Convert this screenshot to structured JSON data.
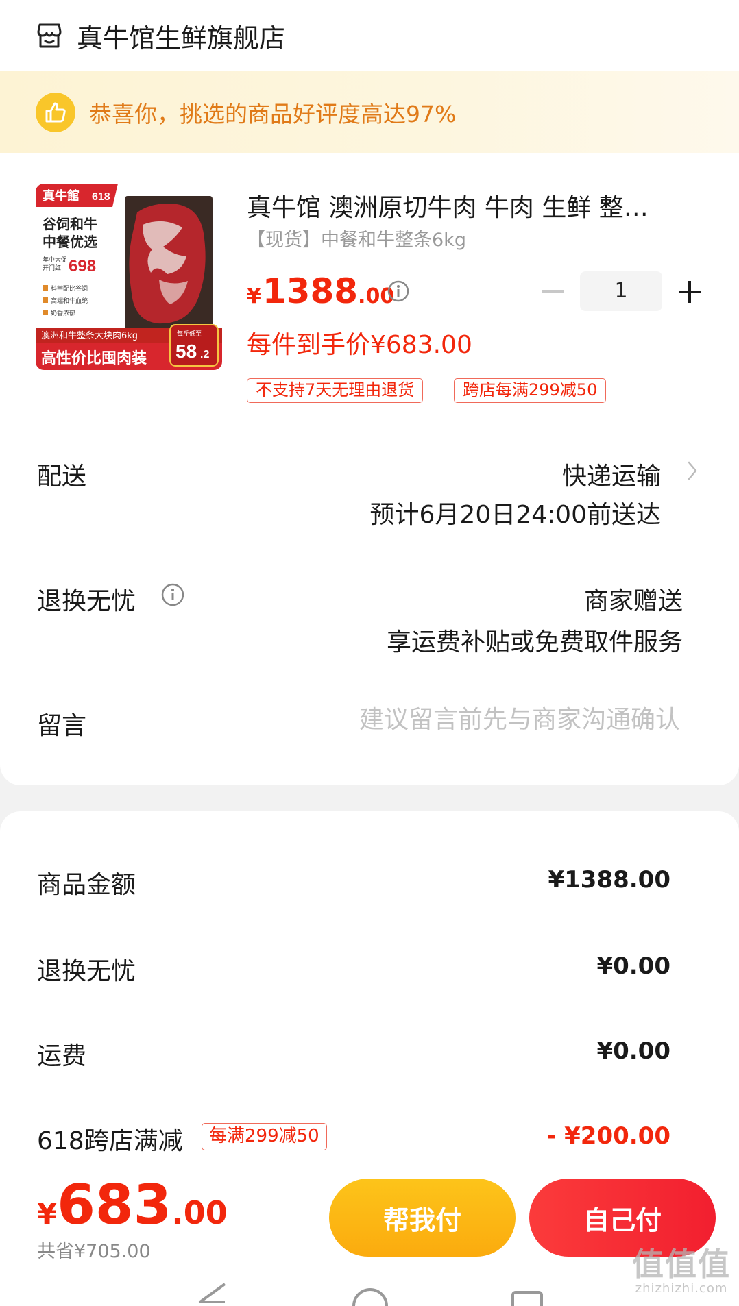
{
  "store": {
    "name": "真牛馆生鲜旗舰店"
  },
  "banner": {
    "text": "恭喜你，挑选的商品好评度高达97%"
  },
  "product": {
    "image": {
      "brand": "真牛館",
      "event": "618",
      "headline1": "谷饲和牛",
      "headline2": "中餐优选",
      "promo_label1": "年中大促",
      "promo_label2": "开门红:",
      "promo_price": "698",
      "features": [
        "科学配比谷饲",
        "高端和牛血统",
        "奶香浓郁"
      ],
      "strip": "澳洲和牛整条大块肉6kg",
      "slogan": "高性价比囤肉装",
      "badge_label": "每斤低至",
      "badge_price": "58",
      "badge_price_dec": ".2"
    },
    "title": "真牛馆 澳洲原切牛肉 牛肉 生鲜 整…",
    "spec": "【现货】中餐和牛整条6kg",
    "price": {
      "yen": "¥",
      "int": "1388",
      "dec": ".00"
    },
    "quantity": "1",
    "deal_price": "每件到手价¥683.00",
    "tags": [
      "不支持7天无理由退货",
      "跨店每满299减50"
    ]
  },
  "delivery": {
    "label": "配送",
    "method": "快递运输",
    "eta": "预计6月20日24:00前送达"
  },
  "returns": {
    "label": "退换无忧",
    "value": "商家赠送",
    "desc": "享运费补贴或免费取件服务"
  },
  "message": {
    "label": "留言",
    "placeholder": "建议留言前先与商家沟通确认"
  },
  "summary": {
    "goods_label": "商品金额",
    "goods_value": "¥1388.00",
    "returns_label": "退换无忧",
    "returns_value": "¥0.00",
    "shipping_label": "运费",
    "shipping_value": "¥0.00",
    "discount_label": "618跨店满减",
    "discount_tag": "每满299减50",
    "discount_value": "- ¥200.00"
  },
  "footer": {
    "total": {
      "yen": "¥",
      "int": "683",
      "dec": ".00"
    },
    "saved": "共省¥705.00",
    "help_pay": "帮我付",
    "self_pay": "自己付"
  },
  "watermark": {
    "big": "值值值",
    "small": "zhizhizhi.com"
  },
  "colors": {
    "price_red": "#f2270c",
    "banner_orange": "#e07a18",
    "help_btn": "#fbab0e",
    "self_btn": "#f21f2f"
  },
  "icons": [
    "store-icon",
    "thumbs-up-icon",
    "info-icon",
    "minus-icon",
    "plus-icon",
    "chevron-right-icon"
  ]
}
